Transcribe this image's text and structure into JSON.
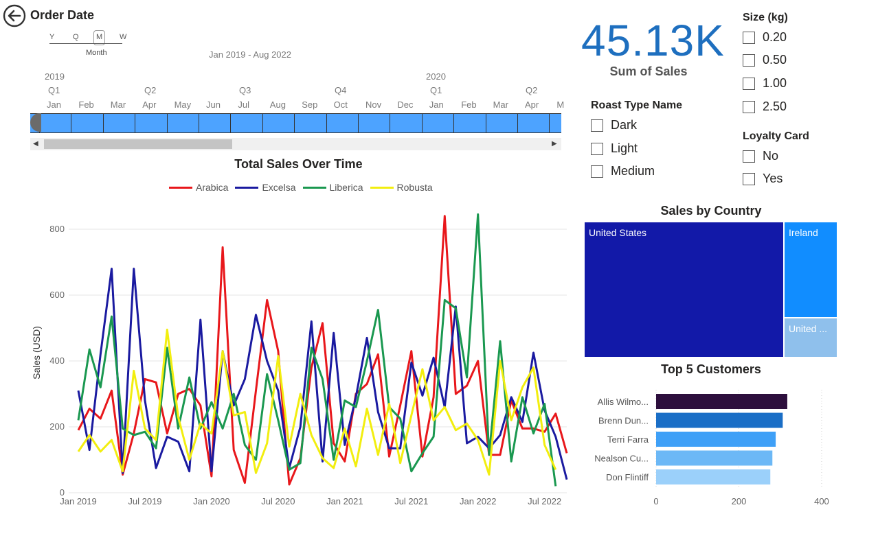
{
  "timeline": {
    "title": "Order Date",
    "granularity": [
      "Y",
      "Q",
      "M",
      "W"
    ],
    "granularity_selected": "Month",
    "range": "Jan 2019 - Aug 2022",
    "years": [
      "2019",
      "2020"
    ],
    "quarters": [
      "Q1",
      "Q2",
      "Q3",
      "Q4",
      "Q1",
      "Q2"
    ],
    "months": [
      "Jan",
      "Feb",
      "Mar",
      "Apr",
      "May",
      "Jun",
      "Jul",
      "Aug",
      "Sep",
      "Oct",
      "Nov",
      "Dec",
      "Jan",
      "Feb",
      "Mar",
      "Apr",
      "M"
    ],
    "colors": {
      "bar": "#4da3ff",
      "scroll": "#c4c4c4"
    }
  },
  "kpi": {
    "value": "45.13K",
    "label": "Sum of Sales",
    "color": "#1e6fbf"
  },
  "slicers": {
    "size": {
      "title": "Size (kg)",
      "items": [
        "0.20",
        "0.50",
        "1.00",
        "2.50"
      ]
    },
    "roast": {
      "title": "Roast Type Name",
      "items": [
        "Dark",
        "Light",
        "Medium"
      ]
    },
    "loyalty": {
      "title": "Loyalty Card",
      "items": [
        "No",
        "Yes"
      ]
    }
  },
  "chart_data": [
    {
      "type": "line",
      "title": "Total Sales Over Time",
      "ylabel": "Sales (USD)",
      "xlabel": "",
      "ylim": [
        0,
        850
      ],
      "yticks": [
        0,
        200,
        400,
        600,
        800
      ],
      "xticks": [
        "Jan 2019",
        "Jul 2019",
        "Jan 2020",
        "Jul 2020",
        "Jan 2021",
        "Jul 2021",
        "Jan 2022",
        "Jul 2022"
      ],
      "x_start": "Jan 2019",
      "grid": true,
      "legend": "top",
      "series": [
        {
          "name": "Arabica",
          "color": "#e8171b",
          "values": [
            190,
            255,
            225,
            310,
            55,
            180,
            345,
            335,
            180,
            300,
            315,
            265,
            50,
            745,
            130,
            30,
            310,
            585,
            430,
            25,
            105,
            380,
            515,
            150,
            95,
            300,
            330,
            420,
            110,
            265,
            430,
            110,
            290,
            840,
            300,
            325,
            400,
            115,
            115,
            280,
            195,
            195,
            185,
            240,
            120
          ]
        },
        {
          "name": "Excelsa",
          "color": "#1a1aa0",
          "values": [
            310,
            130,
            420,
            680,
            60,
            680,
            280,
            75,
            170,
            155,
            65,
            525,
            65,
            430,
            265,
            345,
            540,
            400,
            310,
            75,
            200,
            520,
            95,
            485,
            145,
            290,
            470,
            245,
            135,
            135,
            395,
            295,
            410,
            260,
            565,
            150,
            170,
            135,
            175,
            290,
            215,
            425,
            250,
            170,
            40
          ]
        },
        {
          "name": "Liberica",
          "color": "#1a9850",
          "values": [
            220,
            435,
            320,
            535,
            195,
            175,
            185,
            135,
            440,
            195,
            350,
            195,
            275,
            195,
            300,
            145,
            100,
            360,
            220,
            70,
            90,
            440,
            345,
            100,
            280,
            260,
            400,
            555,
            260,
            225,
            65,
            120,
            170,
            585,
            560,
            350,
            845,
            115,
            460,
            95,
            290,
            180,
            270,
            20,
            null
          ]
        },
        {
          "name": "Robusta",
          "color": "#f2ee0f",
          "values": [
            125,
            175,
            125,
            160,
            65,
            370,
            195,
            160,
            495,
            230,
            100,
            210,
            180,
            430,
            235,
            245,
            60,
            150,
            415,
            140,
            300,
            175,
            105,
            75,
            195,
            80,
            255,
            115,
            270,
            90,
            235,
            375,
            220,
            260,
            190,
            210,
            160,
            55,
            400,
            220,
            320,
            380,
            145,
            70,
            null
          ]
        }
      ]
    },
    {
      "type": "heatmap",
      "title": "Sales by Country",
      "categories": [
        "United States",
        "Ireland",
        "United ..."
      ],
      "colors": [
        "#1219a8",
        "#118dff",
        "#8fc0ec"
      ]
    },
    {
      "type": "bar",
      "orientation": "horizontal",
      "title": "Top 5 Customers",
      "categories": [
        "Allis Wilmo...",
        "Brenn Dun...",
        "Terri Farra",
        "Nealson Cu...",
        "Don Flintiff"
      ],
      "values": [
        317,
        306,
        289,
        281,
        276
      ],
      "colors": [
        "#2d0f3d",
        "#1a6ec6",
        "#3fa0f7",
        "#6cb8f6",
        "#9bd0fa"
      ],
      "xlim": [
        0,
        420
      ],
      "xticks": [
        0,
        200,
        400
      ]
    }
  ]
}
